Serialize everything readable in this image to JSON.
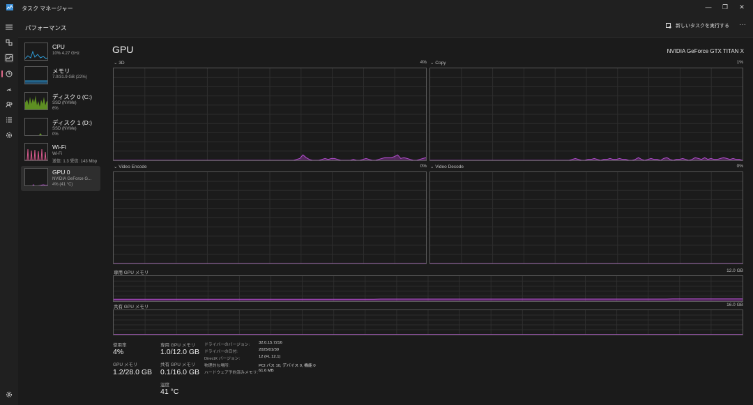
{
  "window": {
    "title": "タスク マネージャー",
    "controls": {
      "minimize": "—",
      "restore": "❐",
      "close": "✕"
    }
  },
  "header": {
    "page_title": "パフォーマンス",
    "run_task_label": "新しいタスクを実行する",
    "more_label": "···"
  },
  "rail": {
    "icons": [
      "menu-icon",
      "processes-icon",
      "performance-icon",
      "app-history-icon",
      "startup-apps-icon",
      "users-icon",
      "details-icon",
      "services-icon",
      "settings-icon"
    ]
  },
  "devices": [
    {
      "name": "CPU",
      "sub1": "10% 4.27 GHz",
      "sub2": "",
      "color": "#2e9bd6"
    },
    {
      "name": "メモリ",
      "sub1": "7.0/31.9 GB (22%)",
      "sub2": "",
      "color": "#2e9bd6"
    },
    {
      "name": "ディスク 0 (C:)",
      "sub1": "SSD (NVMe)",
      "sub2": "6%",
      "color": "#7ab82e"
    },
    {
      "name": "ディスク 1 (D:)",
      "sub1": "SSD (NVMe)",
      "sub2": "0%",
      "color": "#7ab82e"
    },
    {
      "name": "Wi-Fi",
      "sub1": "Wi-Fi",
      "sub2": "送信: 1.3 受信: 143 Mbp",
      "color": "#d95a8e"
    },
    {
      "name": "GPU 0",
      "sub1": "NVIDIA GeForce G...",
      "sub2": "4% (41 °C)",
      "color": "#b44fd0"
    }
  ],
  "gpu": {
    "title": "GPU",
    "model": "NVIDIA GeForce GTX TITAN X",
    "engines": [
      {
        "label": "3D",
        "value": "4%"
      },
      {
        "label": "Copy",
        "value": "1%"
      },
      {
        "label": "Video Encode",
        "value": "0%"
      },
      {
        "label": "Video Decode",
        "value": "0%"
      }
    ],
    "dedicated_memory": {
      "label": "専用 GPU メモリ",
      "max": "12.0 GB"
    },
    "shared_memory": {
      "label": "共有 GPU メモリ",
      "max": "16.0 GB"
    }
  },
  "chart_data": {
    "type": "area",
    "series": [
      {
        "name": "3D",
        "values": [
          0,
          0,
          0,
          0,
          0,
          0,
          0,
          0,
          0,
          0,
          0,
          0,
          0,
          0,
          0,
          0,
          0,
          0,
          0,
          0,
          0,
          0,
          0,
          0,
          0,
          0,
          0,
          0,
          0,
          0,
          0,
          0,
          0,
          0,
          0,
          0,
          0,
          0,
          0,
          0,
          0,
          0,
          0,
          0,
          0,
          0,
          0,
          0,
          0,
          0,
          0,
          0,
          0,
          0,
          0,
          0,
          0,
          0,
          1,
          2,
          6,
          3,
          1,
          0,
          0,
          0,
          1,
          2,
          1,
          2,
          2,
          1,
          0,
          0,
          0,
          0,
          1,
          0,
          0,
          1,
          2,
          1,
          0,
          0,
          1,
          2,
          3,
          3,
          3,
          4,
          6,
          2,
          3,
          2,
          1,
          0,
          0,
          1,
          2,
          3
        ]
      },
      {
        "name": "Copy",
        "values": [
          0,
          0,
          0,
          0,
          0,
          0,
          0,
          0,
          0,
          0,
          0,
          0,
          0,
          0,
          0,
          0,
          0,
          0,
          0,
          0,
          0,
          0,
          0,
          0,
          0,
          0,
          0,
          0,
          0,
          0,
          0,
          0,
          0,
          0,
          0,
          0,
          0,
          0,
          0,
          0,
          0,
          0,
          0,
          0,
          0,
          1,
          2,
          1,
          0,
          0,
          1,
          1,
          2,
          1,
          0,
          1,
          1,
          2,
          1,
          1,
          2,
          1,
          1,
          0,
          0,
          1,
          3,
          1,
          0,
          1,
          2,
          1,
          1,
          0,
          2,
          3,
          1,
          0,
          1,
          1,
          2,
          1,
          0,
          1,
          3,
          2,
          1,
          3,
          1,
          2,
          1,
          1,
          2,
          3,
          2,
          1,
          2,
          1,
          1,
          0
        ]
      },
      {
        "name": "Video Encode",
        "values": [
          0,
          0,
          0,
          0,
          0,
          0,
          0,
          0,
          0,
          0,
          0,
          0,
          0,
          0,
          0,
          0,
          0,
          0,
          0,
          0
        ]
      },
      {
        "name": "Video Decode",
        "values": [
          0,
          0,
          0,
          0,
          0,
          0,
          0,
          0,
          0,
          0,
          0,
          0,
          0,
          0,
          0,
          0,
          0,
          0,
          0,
          0
        ]
      }
    ],
    "ylim": [
      0,
      100
    ],
    "dedicated_gb": [
      0.9,
      0.9,
      0.9,
      0.9,
      0.9,
      0.9,
      0.9,
      0.9,
      0.9,
      0.9,
      0.9,
      0.9,
      0.9,
      0.9,
      0.9,
      0.9,
      0.9,
      0.9,
      0.9,
      0.9,
      0.9,
      0.9,
      0.9,
      0.9,
      0.9,
      0.9,
      0.9,
      0.9,
      0.9,
      0.9,
      0.9,
      0.9,
      0.9,
      0.9,
      0.9,
      0.9,
      0.9,
      0.9,
      0.9,
      0.9,
      0.9,
      0.9,
      1.0,
      1.0,
      1.0,
      1.0,
      1.0,
      1.0,
      1.0,
      1.0,
      1.0,
      1.0,
      1.0,
      1.0,
      1.0,
      1.0,
      1.0,
      1.0,
      1.0,
      1.0,
      1.0,
      1.0,
      1.0,
      1.0,
      1.0,
      1.0,
      1.0,
      1.0,
      1.0,
      1.0,
      1.0,
      1.0,
      1.0,
      1.0,
      1.0,
      1.0,
      1.0,
      1.0,
      1.0,
      1.0,
      1.0,
      1.0,
      1.0,
      1.0,
      1.0,
      1.0,
      1.0,
      1.0,
      1.1,
      1.1,
      1.1,
      1.1,
      1.1,
      1.1,
      1.1,
      1.1,
      1.1,
      1.1,
      1.1,
      1.1
    ],
    "shared_gb": [
      0.1,
      0.1,
      0.1,
      0.1,
      0.1,
      0.1,
      0.1,
      0.1,
      0.1,
      0.1
    ]
  },
  "stats": {
    "utilization": {
      "label": "使用率",
      "value": "4%"
    },
    "gpu_memory": {
      "label": "GPU メモリ",
      "value": "1.2/28.0 GB"
    },
    "dedicated": {
      "label": "専用 GPU メモリ",
      "value": "1.0/12.0 GB"
    },
    "shared": {
      "label": "共有 GPU メモリ",
      "value": "0.1/16.0 GB"
    },
    "temperature": {
      "label": "温度",
      "value": "41 °C"
    }
  },
  "properties": [
    {
      "label": "ドライバーのバージョン:",
      "value": "32.0.15.7216"
    },
    {
      "label": "ドライバーの日付:",
      "value": "2025/01/30"
    },
    {
      "label": "DirectX バージョン:",
      "value": "12 (FL 12.1)"
    },
    {
      "label": "物理的な場所:",
      "value": "PCI バス 10, デバイス 0, 機能 0"
    },
    {
      "label": "ハードウェア予約済みメモリ:",
      "value": "61.6 MB"
    }
  ]
}
